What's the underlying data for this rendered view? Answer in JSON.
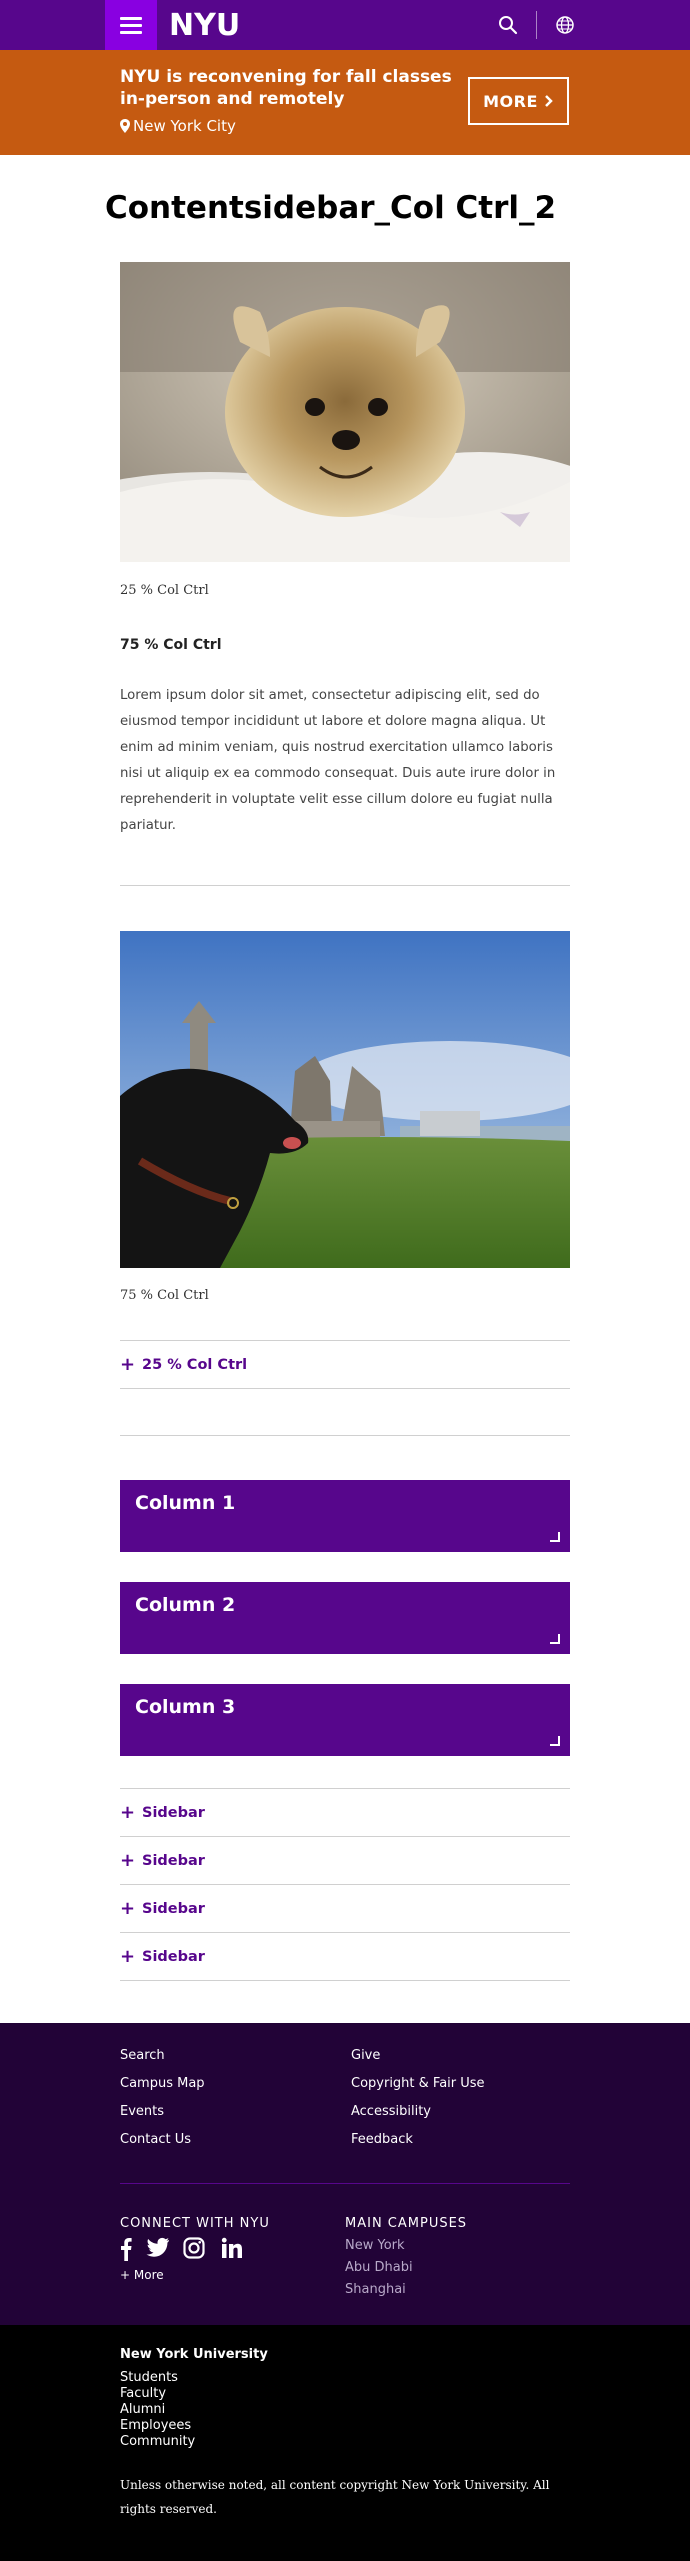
{
  "header": {
    "logo": "NYU",
    "colors": {
      "purple": "#57068c",
      "violet": "#8900e1",
      "orange": "#c55a11"
    }
  },
  "alert": {
    "title": "NYU is reconvening for fall classes in-person and remotely",
    "location": "New York City",
    "more_label": "MORE"
  },
  "page": {
    "title": "Contentsidebar_Col Ctrl_2",
    "section1": {
      "caption": "25 % Col Ctrl",
      "subheading": "75 % Col Ctrl",
      "body": "Lorem ipsum dolor sit amet, consectetur adipiscing elit, sed do eiusmod tempor incididunt ut labore et dolore magna aliqua. Ut enim ad minim veniam, quis nostrud exercitation ullamco laboris nisi ut aliquip ex ea commodo consequat. Duis aute irure dolor in reprehenderit in voluptate velit esse cillum dolore eu fugiat nulla pariatur."
    },
    "section2": {
      "caption": "75 % Col Ctrl",
      "accordion_label": "25 % Col Ctrl"
    },
    "columns": [
      "Column 1",
      "Column 2",
      "Column 3"
    ],
    "sidebar_items": [
      "Sidebar",
      "Sidebar",
      "Sidebar",
      "Sidebar"
    ]
  },
  "footer": {
    "links_left": [
      "Search",
      "Campus Map",
      "Events",
      "Contact Us"
    ],
    "links_right": [
      "Give",
      "Copyright & Fair Use",
      "Accessibility",
      "Feedback"
    ],
    "connect_heading": "CONNECT WITH NYU",
    "more_label": "+ More",
    "campuses_heading": "MAIN CAMPUSES",
    "campuses": [
      "New York",
      "Abu Dhabi",
      "Shanghai"
    ],
    "university": "New York University",
    "audience_links": [
      "Students",
      "Faculty",
      "Alumni",
      "Employees",
      "Community"
    ],
    "copyright": "Unless otherwise noted, all content copyright New York University. All rights reserved."
  }
}
